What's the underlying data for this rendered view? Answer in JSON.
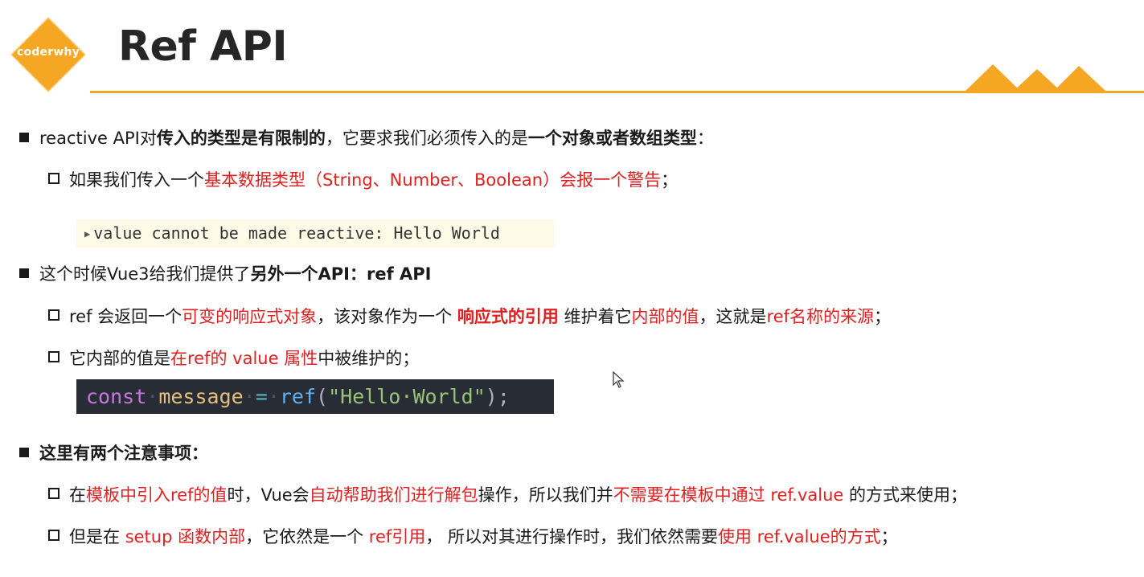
{
  "logo": {
    "text": "coderwhy",
    "color": "#f5a623"
  },
  "title": "Ref API",
  "colors": {
    "accent": "#f5a623",
    "highlight": "#e02020",
    "code_bg": "#282c34"
  },
  "b1": {
    "p1": "reactive API对",
    "p2": "传入的类型是有限制的",
    "p3": "，它要求我们必须传入的是",
    "p4": "一个对象或者数组类型",
    "p5": "："
  },
  "b1_sub": {
    "p1": "如果我们传入一个",
    "p2": "基本数据类型（String、Number、Boolean）会报一个警告",
    "p3": "；"
  },
  "warning": "value cannot be made reactive: Hello World",
  "b2": {
    "p1": "这个时候Vue3给我们提供了",
    "p2": "另外一个API：ref API"
  },
  "b2_sub1": {
    "p1": "ref 会返回一个",
    "p2": "可变的响应式对象",
    "p3": "，该对象作为一个 ",
    "p4": "响应式的引用",
    "p5": " 维护着它",
    "p6": "内部的值",
    "p7": "，这就是",
    "p8": "ref名称的来源",
    "p9": "；"
  },
  "b2_sub2": {
    "p1": "它内部的值是",
    "p2": "在ref的 value 属性",
    "p3": "中被维护的；"
  },
  "code": {
    "kw": "const",
    "var": "message",
    "op": "=",
    "fn": "ref",
    "lp": "(",
    "str": "\"Hello·World\"",
    "rp": ");"
  },
  "b3": {
    "p1": "这里有两个注意事项："
  },
  "b3_sub1": {
    "p1": "在",
    "p2": "模板中引入ref的值",
    "p3": "时，Vue会",
    "p4": "自动帮助我们进行解包",
    "p5": "操作，所以我们并",
    "p6": "不需要在模板中通过 ref.value",
    "p7": " 的方式来使用；"
  },
  "b3_sub2": {
    "p1": "但是在 ",
    "p2": "setup 函数内部",
    "p3": "，它依然是一个 ",
    "p4": "ref引用",
    "p5": "， 所以对其进行操作时，我们依然需要",
    "p6": "使用 ref.value的方式",
    "p7": "；"
  }
}
